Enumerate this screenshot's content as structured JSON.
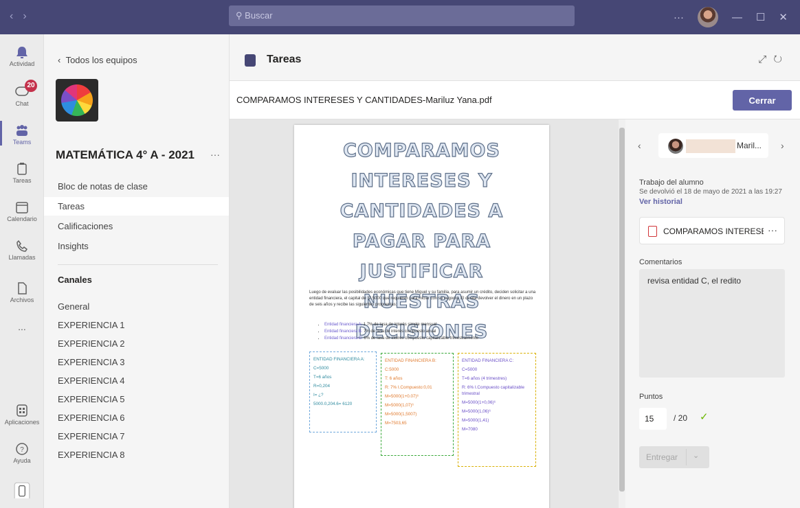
{
  "titlebar": {
    "search_placeholder": "Buscar",
    "more": "···",
    "minimize": "—",
    "maximize": "☐",
    "close": "✕"
  },
  "rail": {
    "items": [
      {
        "label": "Actividad",
        "icon": "bell-icon"
      },
      {
        "label": "Chat",
        "icon": "chat-icon",
        "badge": "20"
      },
      {
        "label": "Teams",
        "icon": "teams-icon"
      },
      {
        "label": "Tareas",
        "icon": "assignments-icon"
      },
      {
        "label": "Calendario",
        "icon": "calendar-icon"
      },
      {
        "label": "Llamadas",
        "icon": "phone-icon"
      },
      {
        "label": "Archivos",
        "icon": "file-icon"
      },
      {
        "label": "...",
        "icon": "more-icon"
      },
      {
        "label": "Aplicaciones",
        "icon": "apps-icon"
      },
      {
        "label": "Ayuda",
        "icon": "help-icon"
      }
    ]
  },
  "sidebar": {
    "back_label": "Todos los equipos",
    "team_name": "MATEMÁTICA 4° A - 2021",
    "team_more": "···",
    "links": [
      "Bloc de notas de clase",
      "Tareas",
      "Calificaciones",
      "Insights"
    ],
    "channels_heading": "Canales",
    "channels": [
      "General",
      "EXPERIENCIA 1",
      "EXPERIENCIA 2",
      "EXPERIENCIA 3",
      "EXPERIENCIA 4",
      "EXPERIENCIA 5",
      "EXPERIENCIA 6",
      "EXPERIENCIA 7",
      "EXPERIENCIA 8"
    ]
  },
  "main": {
    "title": "Tareas",
    "file_name": "COMPARAMOS INTERESES Y CANTIDADES-Mariluz Yana.pdf",
    "close_label": "Cerrar"
  },
  "document": {
    "title_lines": [
      "COMPARAMOS INTERESES Y",
      "CANTIDADES A PAGAR PARA",
      "JUSTIFICAR NUESTRAS",
      "DECISIONES"
    ],
    "intro": "Luego de evaluar las posibilidades económicas que tiene Miguel y su familia, para asumir un crédito, deciden solicitar a una entidad financiera, el capital de S/.5000 que requieren para iniciar con su negocio. El desea devolver el dinero en un plazo de seis años y recibe las siguientes propuestas:",
    "bullets": [
      {
        "label": "Entidad financiera A:",
        "text": "1.7% de tasa de interés simple mensual"
      },
      {
        "label": "Entidad financiera B:",
        "text": "7% de tasa de interés compuesto anual"
      },
      {
        "label": "Entidad financiera C:",
        "text": "6% de tasa de interés compuesto capitalizable trimestralmente"
      }
    ],
    "box_a": [
      "ENTIDAD FINANCIERA A:",
      "C=5000",
      "T=6 años",
      "R=0,204",
      "I= ¿?",
      "5000.0,204.6= 6120"
    ],
    "box_b": [
      "ENTIDAD FINANCIERA B:",
      "C:5000",
      "T: 6 años",
      "R: 7% I.Compuesto:0,01",
      "M=5000(1+0.07)⁶",
      "M=5000(1,07)⁶",
      "M=5000(1,5007)",
      "M=7503,65"
    ],
    "box_c": [
      "ENTIDAD FINANCIERA C:",
      "C=5000",
      "T=6 años (4 trimestres)",
      "R: 6% I.Compuesto capitalizable trimestral",
      "M=5000(1+0,06)⁶",
      "M=5000(1,06)⁶",
      "M=5000(1,41)",
      "M=7080"
    ]
  },
  "panel": {
    "student_name": "Maril...",
    "work_label": "Trabajo del alumno",
    "returned_text": "Se devolvió el 18 de mayo de 2021 a las 19:27",
    "history_link": "Ver historial",
    "file_label": "COMPARAMOS INTERESES",
    "file_more": "···",
    "comments_label": "Comentarios",
    "comment_text": "revisa entidad C,  el redito",
    "points_label": "Puntos",
    "points_value": "15",
    "points_total": "/ 20",
    "submit_label": "Entregar"
  }
}
